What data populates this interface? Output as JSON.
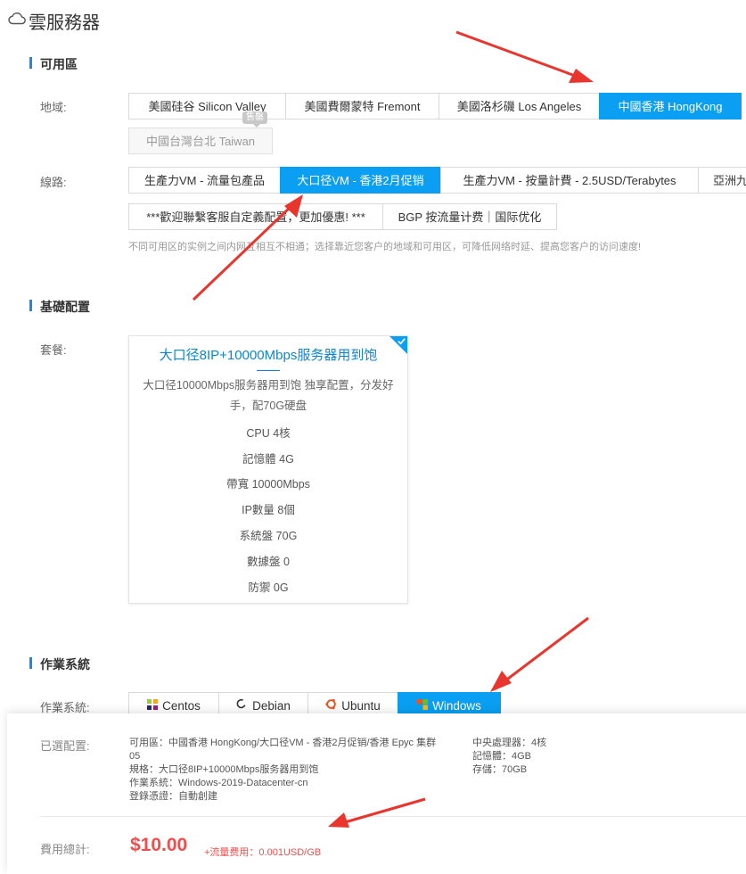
{
  "header": {
    "title": "雲服務器",
    "icon": "cloud-icon"
  },
  "availability": {
    "section_title": "可用區",
    "region_label": "地域:",
    "regions": [
      "美國硅谷 Silicon Valley",
      "美國費爾蒙特 Fremont",
      "美國洛杉磯 Los Angeles",
      "中國香港 HongKong",
      "中國台灣台北 Taiwan"
    ],
    "selected_region": "中國香港 HongKong",
    "taiwan_badge": "售罄",
    "line_label": "線路:",
    "lines": [
      "生產力VM - 流量包產品",
      "大口径VM - 香港2月促销",
      "生產力VM - 按量計費 - 2.5USD/Terabytes",
      "亞洲九"
    ],
    "lines_row2": [
      "***歡迎聯繫客服自定義配置，更加優惠! ***",
      "BGP 按流量计费｜国际优化"
    ],
    "hint": "不同可用区的实例之间内网互相互不相通；选择靠近您客户的地域和可用区，可降低网络时延、提高您客户的访问速度!"
  },
  "basic_config": {
    "section_title": "基礎配置",
    "package_label": "套餐:",
    "card": {
      "title": "大口径8IP+10000Mbps服务器用到饱",
      "description": "大口径10000Mbps服务器用到饱 独享配置，分发好手，配70G硬盘",
      "specs": [
        {
          "key": "CPU",
          "value": "4核"
        },
        {
          "key": "記憶體",
          "value": "4G"
        },
        {
          "key": "帶寬",
          "value": "10000Mbps"
        },
        {
          "key": "IP數量",
          "value": "8個"
        },
        {
          "key": "系統盤",
          "value": "70G"
        },
        {
          "key": "數據盤",
          "value": "0"
        },
        {
          "key": "防禦",
          "value": "0G"
        }
      ],
      "selected_icon": "checkmark-icon"
    }
  },
  "os": {
    "section_title": "作業系統",
    "label": "作業系統:",
    "options": [
      {
        "name": "Centos",
        "icon": "centos-icon"
      },
      {
        "name": "Debian",
        "icon": "debian-icon"
      },
      {
        "name": "Ubuntu",
        "icon": "ubuntu-icon"
      },
      {
        "name": "Windows",
        "icon": "windows-icon"
      }
    ],
    "selected": "Windows"
  },
  "summary": {
    "config_label": "已選配置:",
    "lines": [
      "可用區：中國香港 HongKong/大口径VM - 香港2月促销/香港 Epyc 集群05",
      "規格：大口径8IP+10000Mbps服务器用到饱",
      "作業系統：Windows-2019-Datacenter-cn",
      "登錄憑證：自動創建"
    ],
    "right_lines": [
      "中央處理器：4核",
      "記憶體：4GB",
      "存儲：70GB"
    ],
    "cost_label": "費用總計:",
    "price": "$10.00",
    "extra": "+流量费用：0.001USD/GB"
  },
  "colors": {
    "accent": "#0A9FF2",
    "price": "#F04E4E",
    "annotation_arrow": "#E8352E"
  }
}
